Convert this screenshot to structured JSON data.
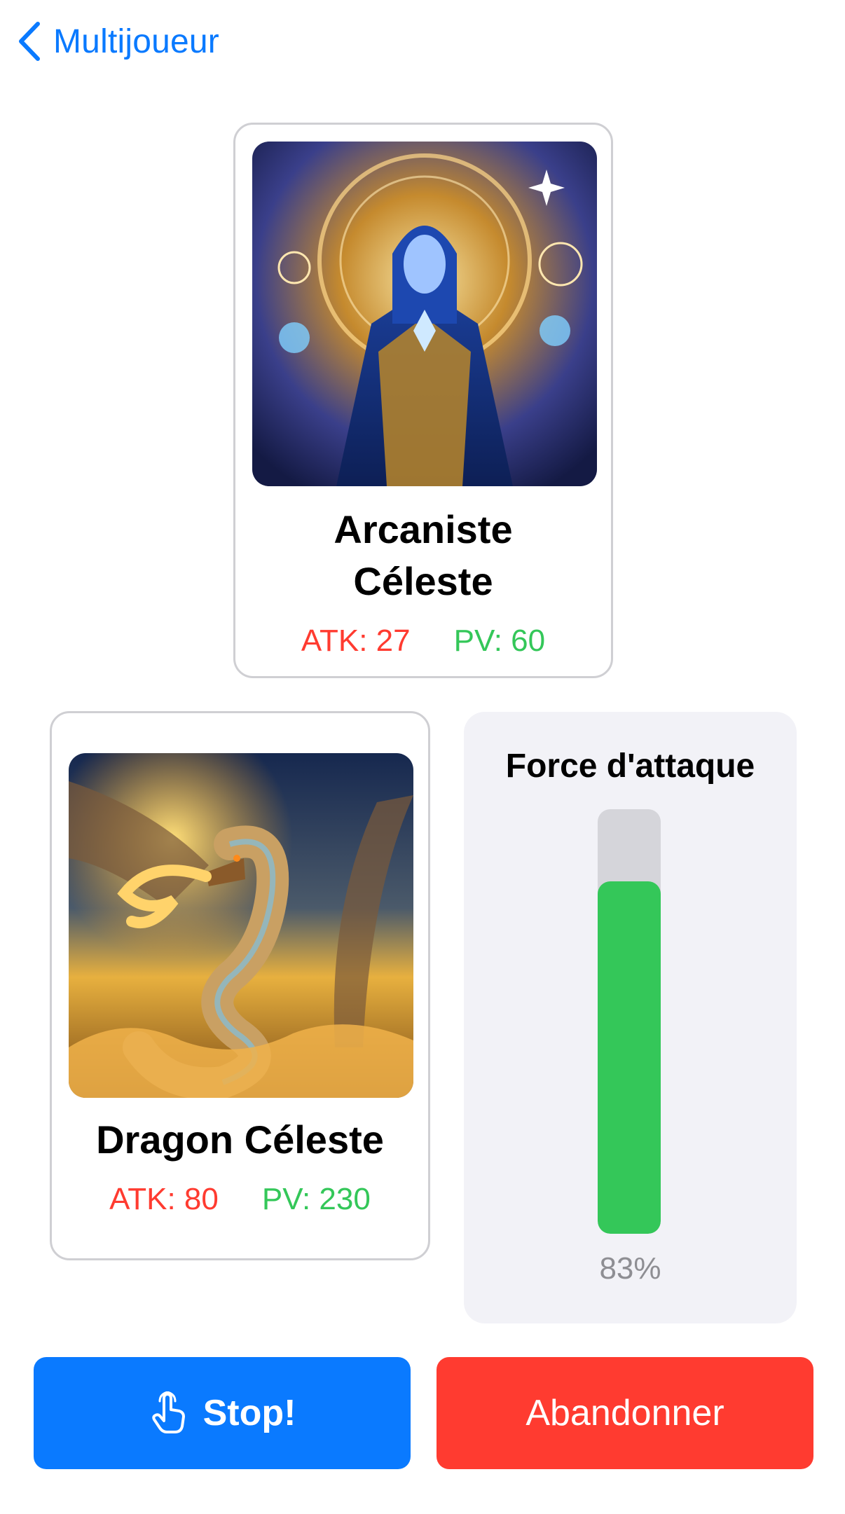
{
  "nav": {
    "back_label": "Multijoueur",
    "back_icon": "chevron-left-icon"
  },
  "enemy_card": {
    "name_line1": "Arcaniste",
    "name_line2": "Céleste",
    "atk": "ATK: 27",
    "pv": "PV: 60",
    "art": "celestial-arcanist-illustration"
  },
  "player_card": {
    "name": "Dragon Céleste",
    "atk": "ATK: 80",
    "pv": "PV: 230",
    "art": "celestial-dragon-illustration"
  },
  "force": {
    "title": "Force d'attaque",
    "value_label": "83%",
    "value": 0.83
  },
  "buttons": {
    "stop_label": "Stop!",
    "stop_icon": "hand-tap-icon",
    "quit_label": "Abandonner"
  },
  "colors": {
    "accent": "#0a7aff",
    "danger": "#ff3b30",
    "success": "#34c759",
    "panel": "#f2f2f7"
  }
}
